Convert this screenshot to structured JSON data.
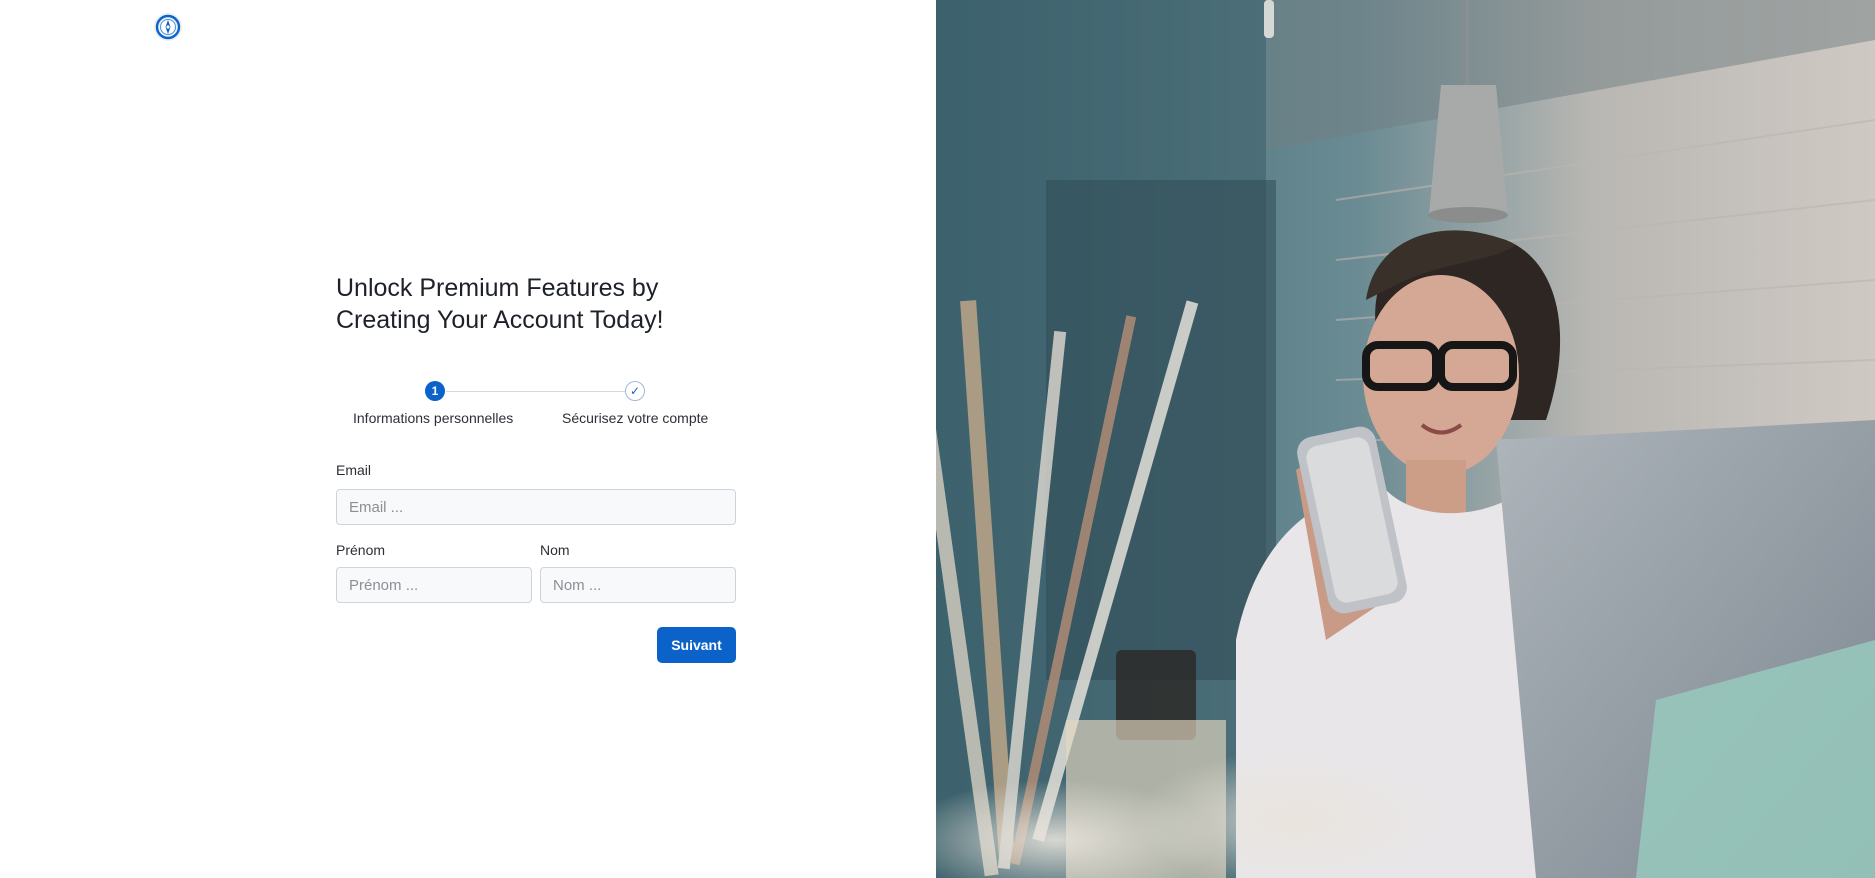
{
  "brand": {
    "logo_icon": "compass-logo-icon",
    "accent_color": "#0b63c9"
  },
  "header": {
    "title": "Unlock Premium Features by Creating Your Account Today!"
  },
  "stepper": {
    "steps": [
      {
        "number": "1",
        "label": "Informations personnelles",
        "state": "active"
      },
      {
        "number": "✓",
        "label": "Sécurisez votre compte",
        "state": "pending"
      }
    ]
  },
  "form": {
    "email": {
      "label": "Email",
      "placeholder": "Email ...",
      "value": ""
    },
    "prenom": {
      "label": "Prénom",
      "placeholder": "Prénom ...",
      "value": ""
    },
    "nom": {
      "label": "Nom",
      "placeholder": "Nom ...",
      "value": ""
    },
    "next_label": "Suivant"
  },
  "hero": {
    "description": "photo-woman-with-phone-at-laptop"
  }
}
